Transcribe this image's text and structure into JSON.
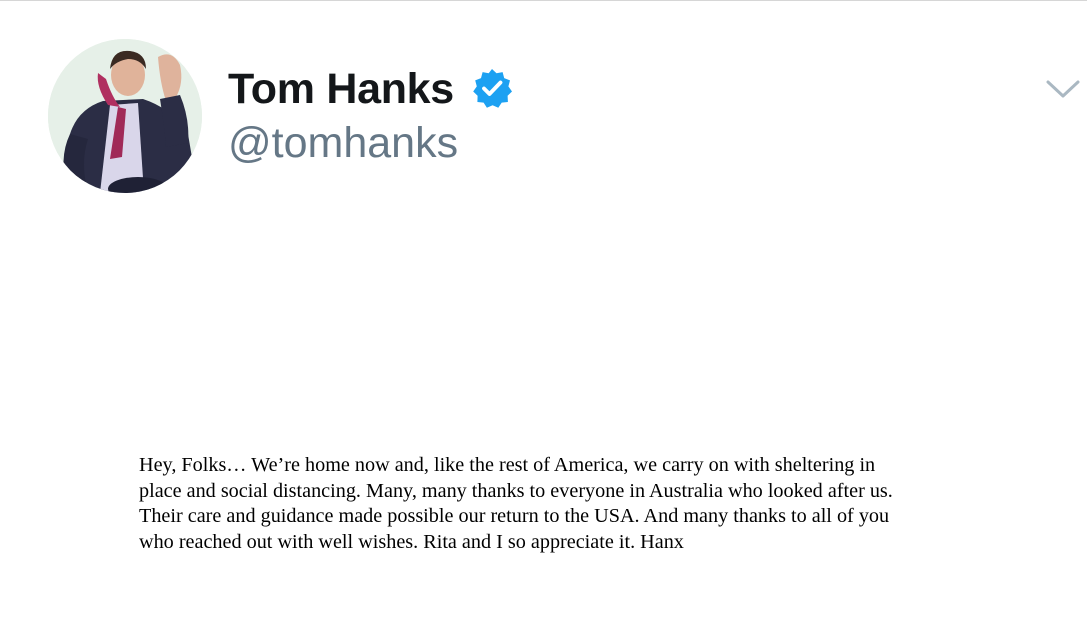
{
  "author": {
    "display_name": "Tom Hanks",
    "handle": "@tomhanks",
    "verified": true
  },
  "menu": {
    "icon": "chevron-down-icon"
  },
  "statement": {
    "lines": [
      "Hey, Folks… We’re home now and, like the rest of America, we carry on with sheltering in",
      "place and social distancing. Many, many thanks to everyone in Australia who looked after us.",
      "Their care and guidance made possible our return to the USA. And many thanks to all of you",
      "who reached out with well wishes. Rita and I so appreciate it. Hanx"
    ]
  },
  "colors": {
    "verified_badge": "#1da1f2",
    "handle": "#657786",
    "name": "#14171a"
  }
}
